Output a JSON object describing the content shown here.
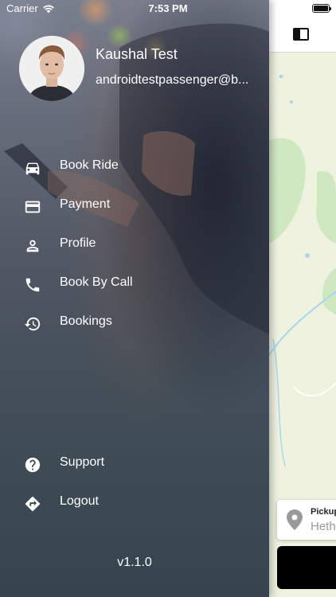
{
  "status_bar": {
    "carrier": "Carrier",
    "time": "7:53 PM"
  },
  "drawer": {
    "user": {
      "name": "Kaushal Test",
      "email": "androidtestpassenger@b..."
    },
    "menu_items": [
      {
        "label": "Book Ride",
        "icon": "car-icon"
      },
      {
        "label": "Payment",
        "icon": "credit-card-icon"
      },
      {
        "label": "Profile",
        "icon": "person-icon"
      },
      {
        "label": "Book By Call",
        "icon": "phone-icon"
      },
      {
        "label": "Bookings",
        "icon": "history-icon"
      }
    ],
    "bottom_items": [
      {
        "label": "Support",
        "icon": "help-circle-icon"
      },
      {
        "label": "Logout",
        "icon": "directions-icon"
      }
    ],
    "version": "v1.1.0"
  },
  "map": {
    "pickup_title": "Pickup",
    "pickup_value": "Heth"
  },
  "colors": {
    "drawer_bottom": "#35444f",
    "map_background": "#eef2df",
    "park_green": "#cfe8c2",
    "water_blue": "#a9d5f0"
  }
}
